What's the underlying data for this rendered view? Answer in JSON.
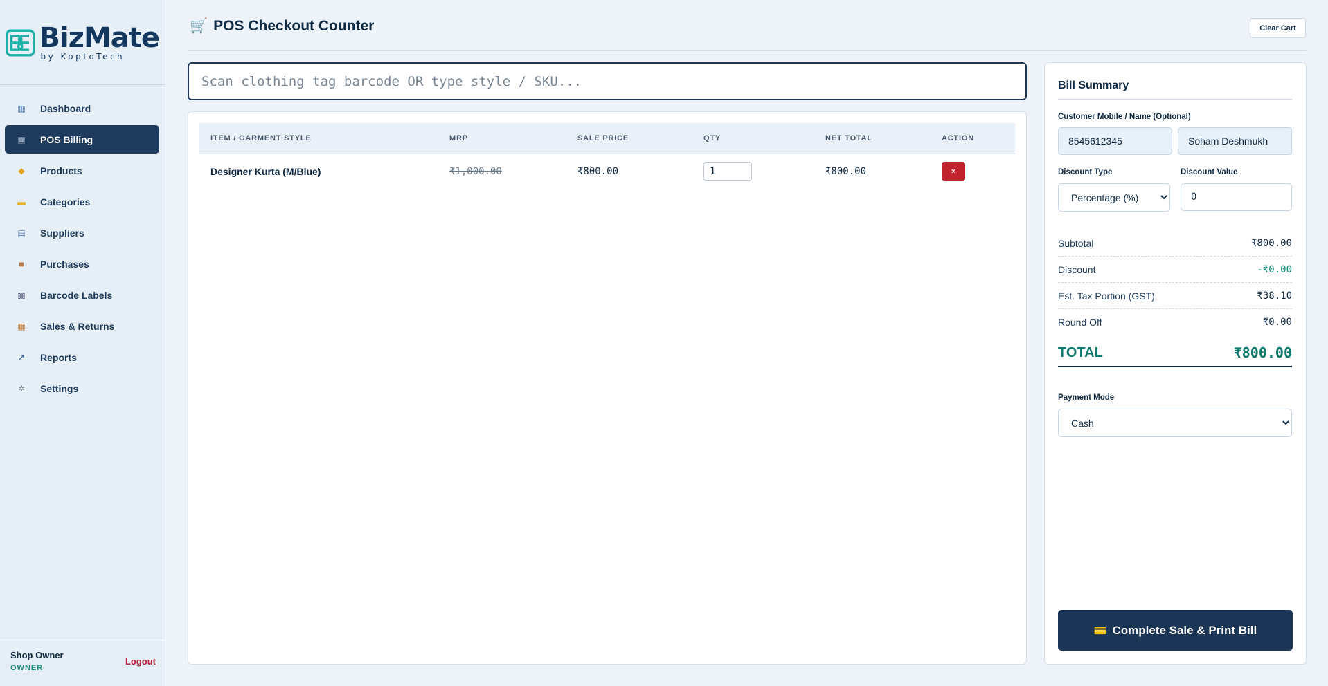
{
  "brand": {
    "name": "BizMate",
    "tagline": "by KoptoTech"
  },
  "sidebar": {
    "items": [
      {
        "label": "Dashboard",
        "icon": "dashboard-icon",
        "glyph": "▥",
        "color": "#3b6fb6"
      },
      {
        "label": "POS Billing",
        "icon": "pos-icon",
        "glyph": "▣",
        "color": "#8aa0b8",
        "active": true
      },
      {
        "label": "Products",
        "icon": "tag-icon",
        "glyph": "◆",
        "color": "#e0a31a"
      },
      {
        "label": "Categories",
        "icon": "folder-icon",
        "glyph": "▬",
        "color": "#e7b32a"
      },
      {
        "label": "Suppliers",
        "icon": "building-icon",
        "glyph": "▤",
        "color": "#5a7aa8"
      },
      {
        "label": "Purchases",
        "icon": "package-icon",
        "glyph": "■",
        "color": "#b7794a"
      },
      {
        "label": "Barcode Labels",
        "icon": "printer-icon",
        "glyph": "▩",
        "color": "#54597a"
      },
      {
        "label": "Sales & Returns",
        "icon": "receipt-icon",
        "glyph": "▦",
        "color": "#c9843a"
      },
      {
        "label": "Reports",
        "icon": "chart-icon",
        "glyph": "↗",
        "color": "#4a6c96"
      },
      {
        "label": "Settings",
        "icon": "gear-icon",
        "glyph": "✲",
        "color": "#7a8794"
      }
    ],
    "user": {
      "name": "Shop Owner",
      "role": "OWNER"
    },
    "logout_label": "Logout"
  },
  "header": {
    "title": "POS Checkout Counter",
    "clear_cart_label": "Clear Cart"
  },
  "search": {
    "placeholder": "Scan clothing tag barcode OR type style / SKU..."
  },
  "cart": {
    "columns": [
      "ITEM / GARMENT STYLE",
      "MRP",
      "SALE PRICE",
      "QTY",
      "NET TOTAL",
      "ACTION"
    ],
    "rows": [
      {
        "item": "Designer Kurta (M/Blue)",
        "mrp": "₹1,000.00",
        "sale_price": "₹800.00",
        "qty": "1",
        "net_total": "₹800.00",
        "action": "×"
      }
    ]
  },
  "bill": {
    "title": "Bill Summary",
    "customer_label": "Customer Mobile / Name (Optional)",
    "customer_mobile": "8545612345",
    "customer_name": "Soham Deshmukh",
    "discount_type_label": "Discount Type",
    "discount_type_value": "Percentage (%)",
    "discount_value_label": "Discount Value",
    "discount_value": "0",
    "subtotal_label": "Subtotal",
    "subtotal": "₹800.00",
    "discount_label": "Discount",
    "discount": "-₹0.00",
    "tax_label": "Est. Tax Portion (GST)",
    "tax": "₹38.10",
    "roundoff_label": "Round Off",
    "roundoff": "₹0.00",
    "total_label": "TOTAL",
    "total": "₹800.00",
    "payment_mode_label": "Payment Mode",
    "payment_mode": "Cash",
    "complete_label": "Complete Sale & Print Bill"
  },
  "colors": {
    "navy": "#1e3a5c",
    "teal": "#1a8a7c",
    "danger": "#c0232e"
  }
}
